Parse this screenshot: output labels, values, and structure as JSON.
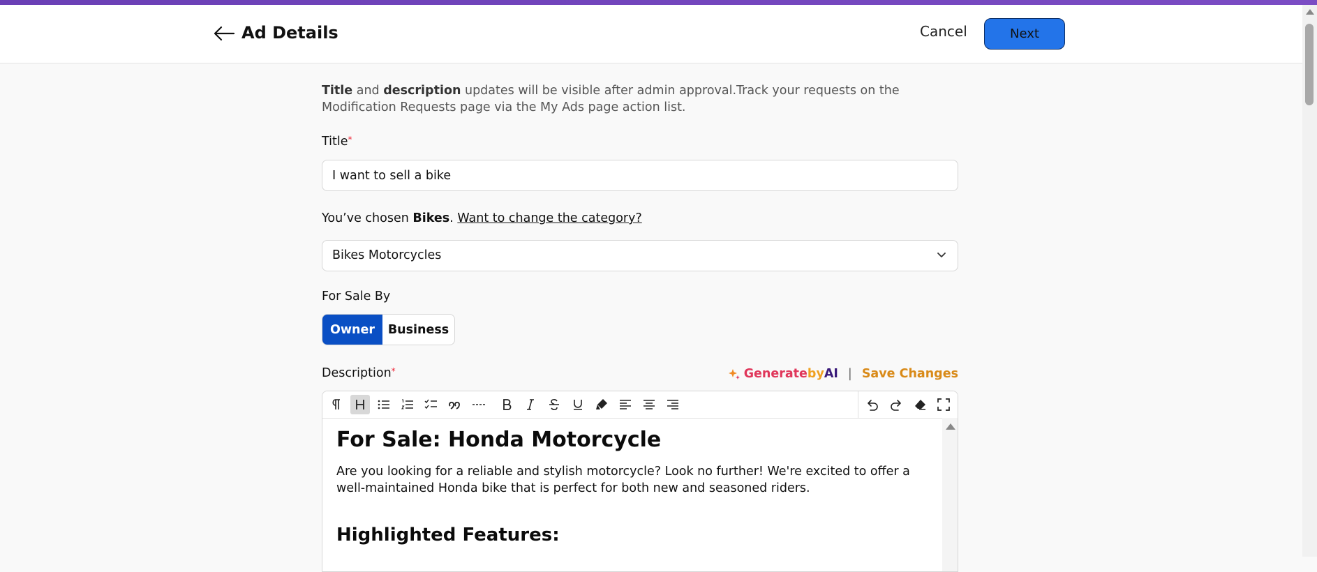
{
  "header": {
    "title": "Ad Details",
    "cancel_label": "Cancel",
    "next_label": "Next"
  },
  "notice": {
    "bold1": "Title",
    "text1": " and ",
    "bold2": "description",
    "text2": " updates will be visible after admin approval.Track your requests on the Modification Requests page via the My Ads page action list."
  },
  "title_field": {
    "label": "Title",
    "required_mark": "*",
    "value": "I want to sell a bike"
  },
  "category": {
    "prefix": "You’ve chosen ",
    "chosen": "Bikes",
    "period": ".",
    "change_link": "Want to change the category?",
    "selected": "Bikes Motorcycles"
  },
  "sale_by": {
    "label": "For Sale By",
    "options": [
      "Owner",
      "Business"
    ],
    "selected": "Owner"
  },
  "description": {
    "label": "Description",
    "required_mark": "*",
    "ai_parts": [
      "Generate ",
      "by ",
      "AI"
    ],
    "separator": "|",
    "save_changes": "Save Changes",
    "toolbar": [
      "paragraph-icon",
      "heading-icon",
      "bullet-list-icon",
      "numbered-list-icon",
      "task-list-icon",
      "blockquote-icon",
      "horizontal-rule-icon",
      "bold-icon",
      "italic-icon",
      "strikethrough-icon",
      "underline-icon",
      "highlight-icon",
      "align-left-icon",
      "align-center-icon",
      "align-right-icon",
      "undo-icon",
      "redo-icon",
      "clear-format-icon",
      "fullscreen-icon"
    ],
    "content": {
      "heading": "For Sale: Honda Motorcycle",
      "paragraph": "Are you looking for a reliable and stylish motorcycle? Look no further! We're excited to offer a well-maintained Honda bike that is perfect for both new and seasoned riders.",
      "subheading": "Highlighted Features:"
    }
  },
  "colors": {
    "primary": "#2374e9",
    "toggle_active": "#0a4fc4",
    "top_accent": "#6a3fb5",
    "generate_pink": "#e0365a",
    "generate_orange": "#f0a020",
    "save_changes": "#d98a18"
  }
}
